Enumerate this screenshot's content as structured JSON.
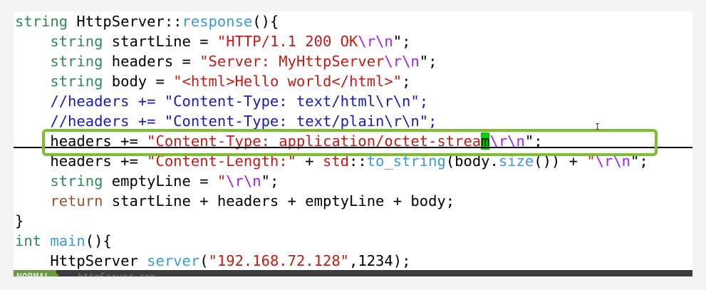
{
  "code_lines": [
    [
      "string",
      " HttpServer::",
      "response",
      "(){"
    ],
    [
      "    ",
      "string",
      " startLine = ",
      "\"HTTP/1.1 200 OK",
      "\\r\\n",
      "\";"
    ],
    [
      "    ",
      "string",
      " headers = ",
      "\"Server: MyHttpServer",
      "\\r\\n",
      "\";"
    ],
    [
      "    ",
      "string",
      " body = ",
      "\"<html>Hello world</html>\"",
      ";"
    ],
    [
      "    ",
      "//headers += \"Content-Type: text/html\\r\\n\";"
    ],
    [
      "    ",
      "//headers += \"Content-Type: text/plain\\r\\n\";"
    ],
    [
      "    headers += ",
      "\"Content-Type: application/octet-strea",
      "m",
      "\\r\\n",
      "\";"
    ],
    [
      "    headers += ",
      "\"Content-Length:\"",
      " + ",
      "std",
      "::",
      "to_string",
      "(body.",
      "size",
      "()) + ",
      "\"",
      "\\r\\n",
      "\";"
    ],
    [
      "    ",
      "string",
      " emptyLine = ",
      "\"",
      "\\r\\n",
      "\";"
    ],
    [
      "    ",
      "return",
      " startLine + headers + emptyLine + body;"
    ],
    [
      "}"
    ],
    [
      "int",
      " ",
      "main",
      "(){"
    ],
    [
      "    HttpServer ",
      "server",
      "(",
      "\"192.168.72.128\"",
      ",1234);"
    ]
  ],
  "statusline": {
    "mode": "NORMAL",
    "file": "httpServer.cpp"
  },
  "colors": {
    "keyword": "#2e8b57",
    "string": "#c41a16",
    "escape": "#a020f0",
    "function": "#3a9ad9",
    "comment": "#1a1ab4",
    "highlight_box": "#7cbf2e",
    "cursor": "#00d000"
  }
}
